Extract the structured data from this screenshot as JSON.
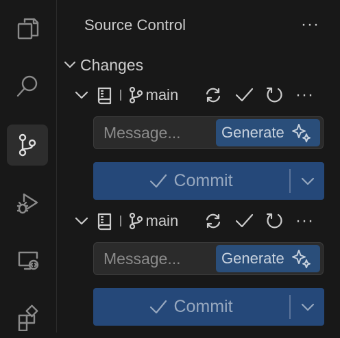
{
  "activity_bar": {
    "items": [
      {
        "name": "explorer-icon",
        "active": false
      },
      {
        "name": "search-icon",
        "active": false
      },
      {
        "name": "source-control-icon",
        "active": true
      },
      {
        "name": "run-debug-icon",
        "active": false
      },
      {
        "name": "remote-explorer-icon",
        "active": false
      },
      {
        "name": "extensions-icon",
        "active": false
      }
    ]
  },
  "panel": {
    "title": "Source Control",
    "more_label": "···"
  },
  "section": {
    "label": "Changes"
  },
  "repos": [
    {
      "branch": "main",
      "more_label": "···",
      "message_placeholder": "Message...",
      "generate_label": "Generate",
      "commit_label": "Commit"
    },
    {
      "branch": "main",
      "more_label": "···",
      "message_placeholder": "Message...",
      "generate_label": "Generate",
      "commit_label": "Commit"
    }
  ],
  "colors": {
    "background": "#181818",
    "accent_button": "#254879",
    "generate_button": "#2a4e7a",
    "text": "#cccccc"
  }
}
